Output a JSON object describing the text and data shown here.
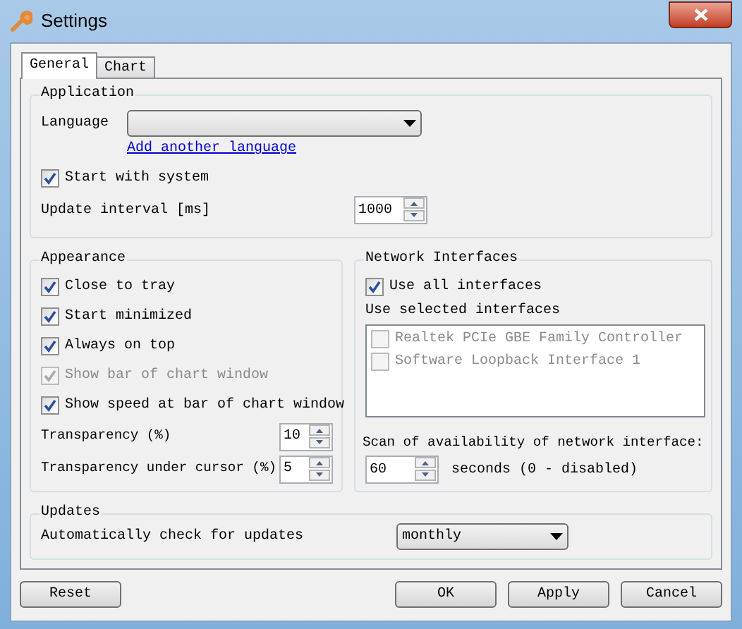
{
  "window": {
    "title": "Settings"
  },
  "tabs": [
    {
      "label": "General",
      "selected": true
    },
    {
      "label": "Chart",
      "selected": false
    }
  ],
  "application": {
    "title": "Application",
    "language_label": "Language",
    "add_language_link": "Add another language",
    "start_with_system": {
      "label": "Start with system",
      "checked": true
    },
    "update_interval": {
      "label": "Update interval [ms]",
      "value": "1000"
    }
  },
  "appearance": {
    "title": "Appearance",
    "checkboxes": [
      {
        "label": "Close to tray",
        "checked": true,
        "disabled": false
      },
      {
        "label": "Start minimized",
        "checked": true,
        "disabled": false
      },
      {
        "label": "Always on top",
        "checked": true,
        "disabled": false
      },
      {
        "label": "Show bar of chart window",
        "checked": true,
        "disabled": true
      },
      {
        "label": "Show speed at bar of chart window",
        "checked": true,
        "disabled": false
      }
    ],
    "spinners": [
      {
        "label": "Transparency (%)",
        "value": "10"
      },
      {
        "label": "Transparency under cursor (%)",
        "value": "5"
      }
    ]
  },
  "network": {
    "title": "Network Interfaces",
    "use_all": {
      "label": "Use all interfaces",
      "checked": true
    },
    "selected_label": "Use selected interfaces",
    "interfaces": [
      {
        "label": "Realtek PCIe GBE Family Controller",
        "checked": false,
        "disabled": true
      },
      {
        "label": "Software Loopback Interface 1",
        "checked": false,
        "disabled": true
      }
    ],
    "scan_label": "Scan of availability of network interface:",
    "scan_value": "60",
    "scan_suffix": "seconds (0 - disabled)"
  },
  "updates": {
    "title": "Updates",
    "label": "Automatically check for updates",
    "value": "monthly"
  },
  "buttons": {
    "left": [
      {
        "label": "Reset"
      }
    ],
    "right": [
      {
        "label": "OK"
      },
      {
        "label": "Apply"
      },
      {
        "label": "Cancel"
      }
    ]
  }
}
